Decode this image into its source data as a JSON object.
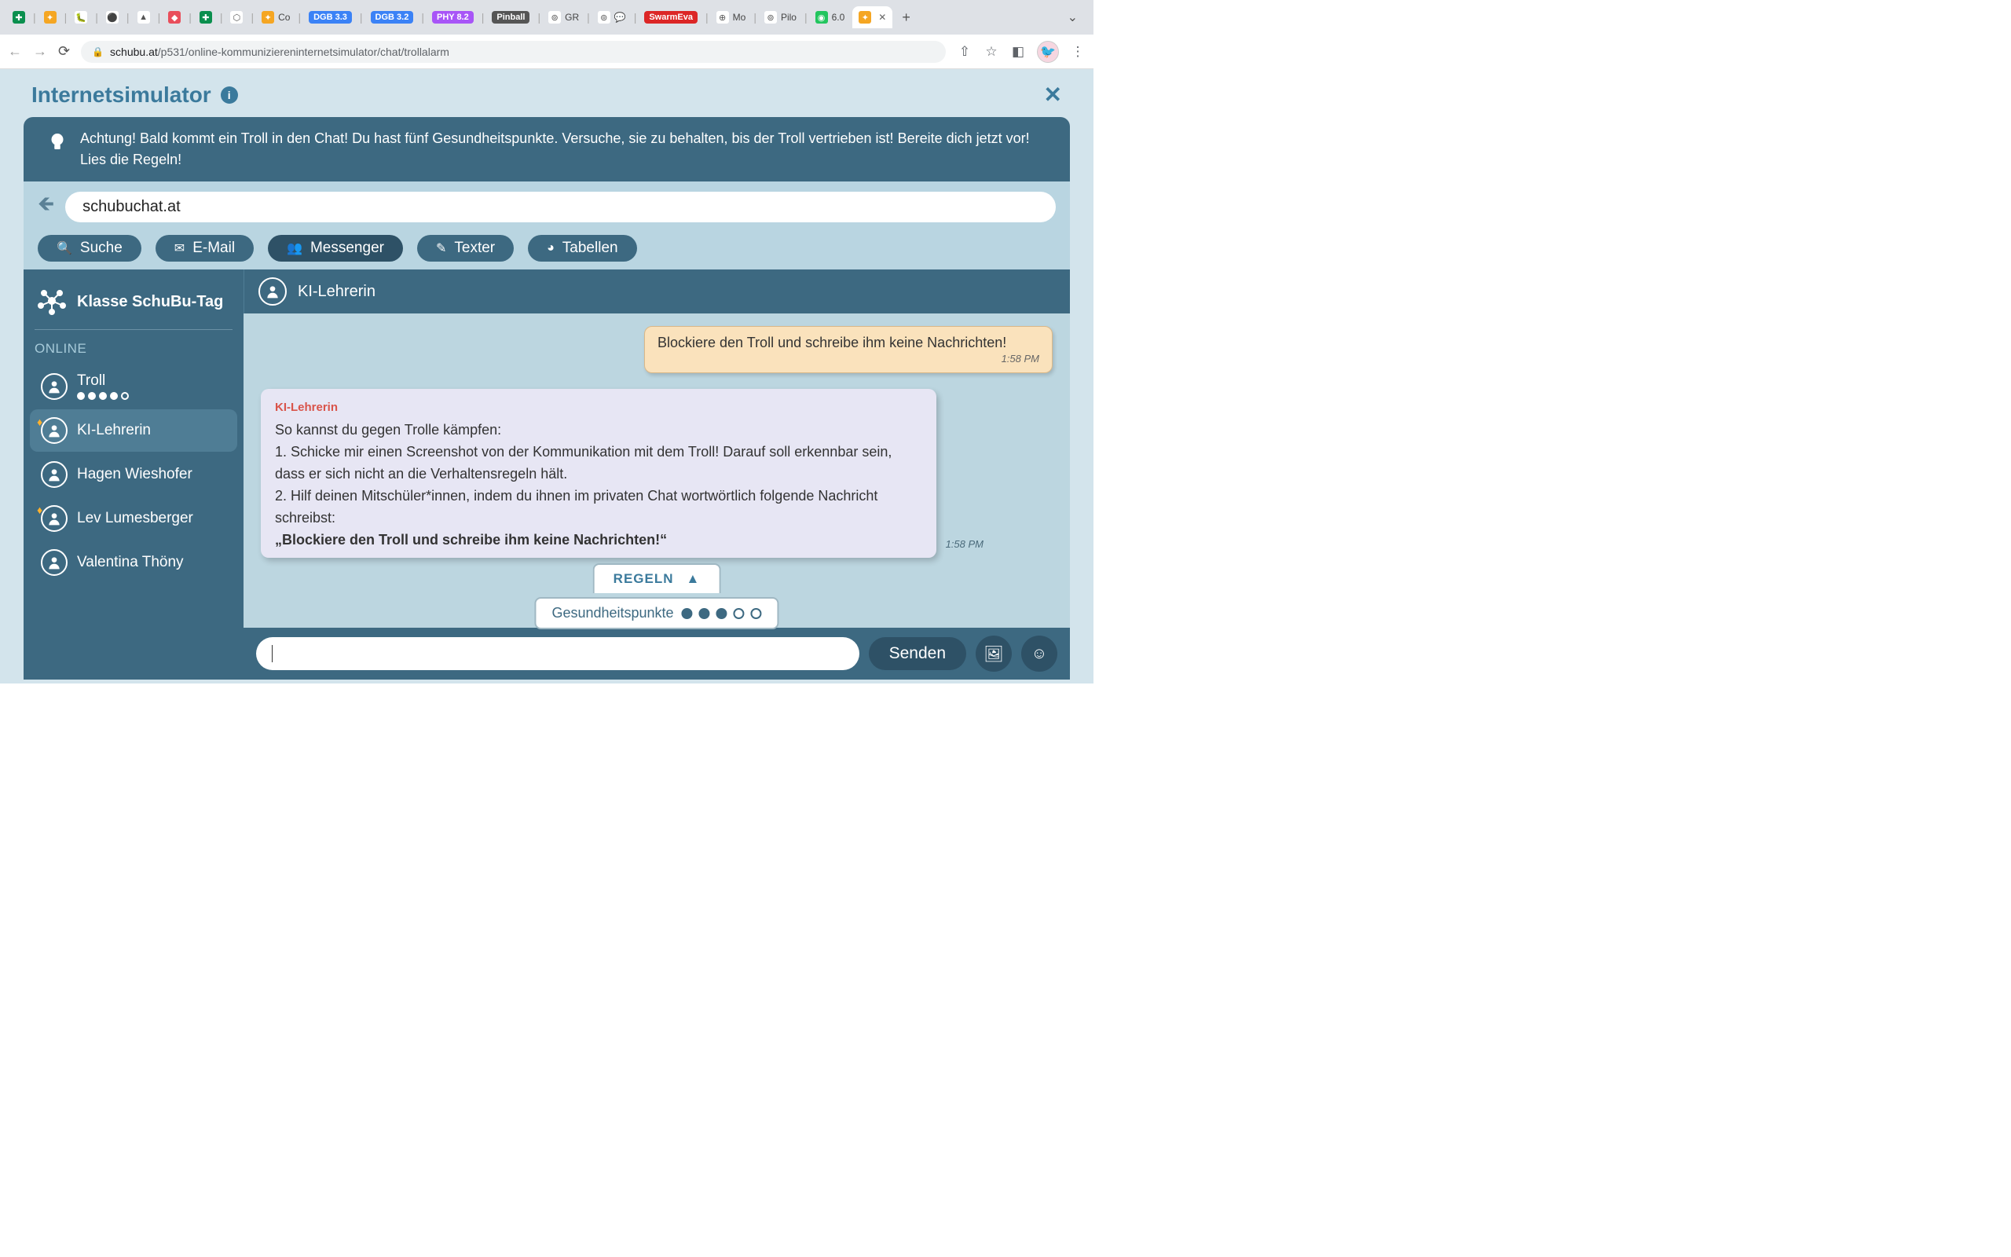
{
  "browser": {
    "tabs": [
      {
        "icon_bg": "#0a8f4e",
        "icon_txt": "✚"
      },
      {
        "icon_bg": "#f5a623",
        "icon_txt": "✦"
      },
      {
        "icon_bg": "#fff",
        "icon_txt": "🐛"
      },
      {
        "icon_bg": "#fff",
        "icon_txt": "⚫"
      },
      {
        "icon_bg": "#fff",
        "icon_txt": "▲"
      },
      {
        "icon_bg": "#e94e5b",
        "icon_txt": "◆"
      },
      {
        "icon_bg": "#0a8f4e",
        "icon_txt": "✚"
      },
      {
        "icon_bg": "#fff",
        "icon_txt": "⬡"
      },
      {
        "icon_bg": "#f5a623",
        "icon_txt": "✦",
        "label": "Co"
      },
      {
        "badge": "DGB 3.3",
        "badge_bg": "#3b82f6"
      },
      {
        "badge": "DGB 3.2",
        "badge_bg": "#3b82f6"
      },
      {
        "badge": "PHY 8.2",
        "badge_bg": "#a855f7"
      },
      {
        "badge": "Pinball",
        "badge_bg": "#555"
      },
      {
        "icon_bg": "#fff",
        "icon_txt": "⊚",
        "label": "GR"
      },
      {
        "icon_bg": "#fff",
        "icon_txt": "⊚",
        "label2_icon": "💬"
      },
      {
        "badge": "SwarmEva",
        "badge_bg": "#dc2626"
      },
      {
        "icon_bg": "#fff",
        "icon_txt": "⊕",
        "label": "Mo"
      },
      {
        "icon_bg": "#fff",
        "icon_txt": "⊚",
        "label": "Pilo"
      },
      {
        "icon_bg": "#22c55e",
        "icon_txt": "◉",
        "label": "6.0"
      },
      {
        "icon_bg": "#f5a623",
        "icon_txt": "✦",
        "active": true
      }
    ],
    "url_domain": "schubu.at",
    "url_path": "/p531/online-kommuniziereninternetsimulator/chat/trollalarm"
  },
  "page": {
    "title": "Internetsimulator",
    "alert": "Achtung! Bald kommt ein Troll in den Chat! Du hast fünf Gesundheitspunkte. Versuche, sie zu behalten, bis der Troll vertrieben ist! Bereite dich jetzt vor! Lies die Regeln!",
    "sim_url": "schubuchat.at",
    "tools": [
      {
        "icon": "🔍",
        "label": "Suche"
      },
      {
        "icon": "✉",
        "label": "E-Mail"
      },
      {
        "icon": "👥",
        "label": "Messenger",
        "selected": true
      },
      {
        "icon": "✎",
        "label": "Texter"
      },
      {
        "icon": "◕",
        "label": "Tabellen"
      }
    ],
    "class_name": "Klasse SchuBu-Tag",
    "online_label": "ONLINE",
    "contacts": [
      {
        "name": "Troll",
        "dots": 5,
        "dots_filled": 4
      },
      {
        "name": "KI-Lehrerin",
        "diamond": true,
        "selected": true
      },
      {
        "name": "Hagen Wieshofer"
      },
      {
        "name": "Lev Lumesberger",
        "diamond": true
      },
      {
        "name": "Valentina Thöny"
      }
    ],
    "chat_with": "KI-Lehrerin",
    "msg_out": {
      "text": "Blockiere den Troll und schreibe ihm keine Nachrichten!",
      "time": "1:58 PM"
    },
    "msg_in": {
      "sender": "KI-Lehrerin",
      "line1": "So kannst du gegen Trolle kämpfen:",
      "line2": "1. Schicke mir einen Screenshot von der Kommunikation mit dem Troll! Darauf soll erkennbar sein, dass er sich nicht an die Verhaltensregeln hält.",
      "line3": "2. Hilf deinen Mitschüler*innen, indem du ihnen im privaten Chat wortwörtlich folgende Nachricht schreibst:",
      "line4": "„Blockiere den Troll und schreibe ihm keine Nachrichten!“",
      "time": "1:58 PM"
    },
    "rules_label": "REGELN",
    "health_label": "Gesundheitspunkte",
    "health_total": 5,
    "health_full": 3,
    "send_label": "Senden"
  }
}
